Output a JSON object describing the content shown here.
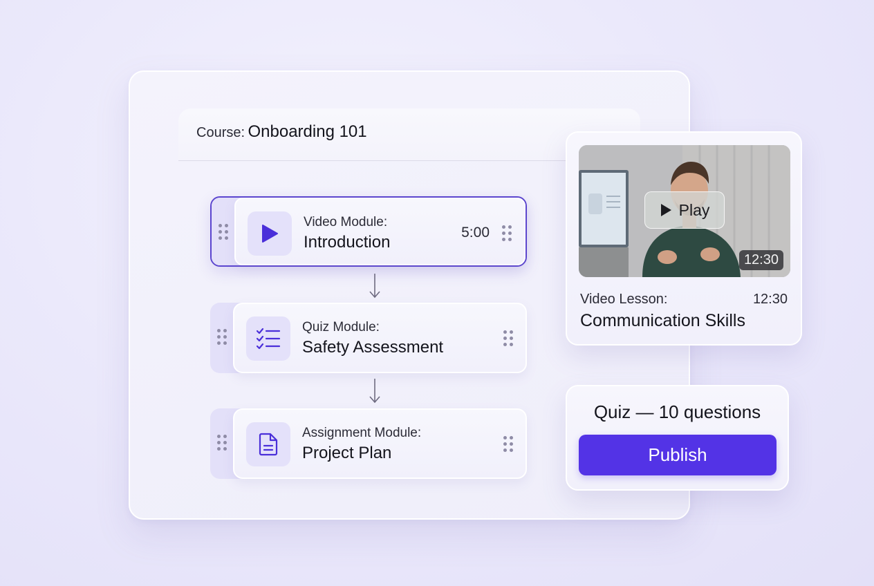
{
  "course": {
    "label": "Course:",
    "name": "Onboarding 101"
  },
  "modules": [
    {
      "type": "Video Module:",
      "name": "Introduction",
      "duration": "5:00",
      "icon": "play-icon",
      "active": true
    },
    {
      "type": "Quiz Module:",
      "name": "Safety Assessment",
      "icon": "checklist-icon",
      "active": false
    },
    {
      "type": "Assignment Module:",
      "name": "Project Plan",
      "icon": "document-icon",
      "active": false
    }
  ],
  "video_lesson": {
    "play_label": "Play",
    "thumbnail_duration": "12:30",
    "type": "Video Lesson:",
    "duration": "12:30",
    "name": "Communication Skills"
  },
  "quiz": {
    "title": "Quiz — 10 questions",
    "publish_label": "Publish"
  },
  "colors": {
    "accent": "#5333e6",
    "active_border": "#5b45cf",
    "icon_bg": "#e4e1fa",
    "icon_fg": "#4a2fd9"
  }
}
